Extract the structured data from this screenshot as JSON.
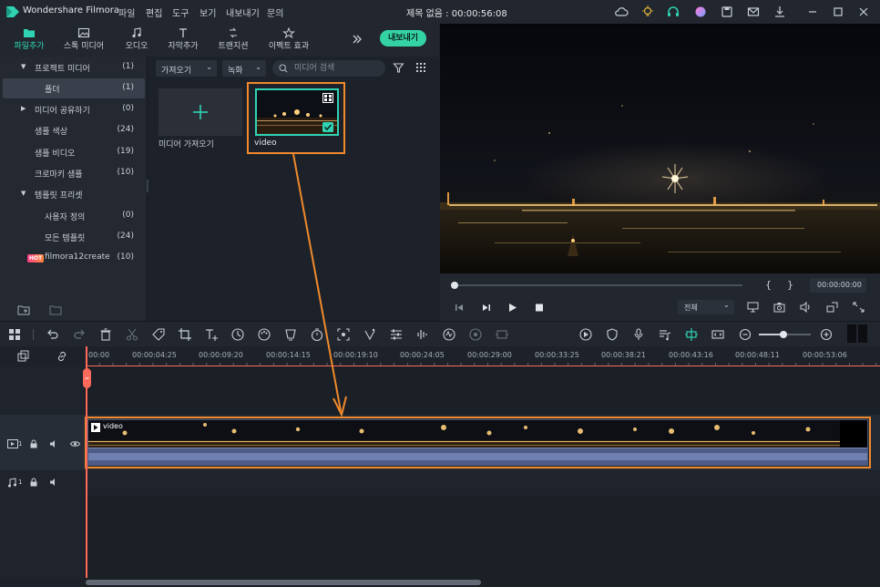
{
  "app": {
    "name": "Wondershare Filmora",
    "title": "제목 없음 : 00:00:56:08",
    "menus": [
      "파일",
      "편집",
      "도구",
      "보기",
      "내보내기",
      "문의"
    ]
  },
  "tabs": [
    {
      "label": "파일추가",
      "icon": "folder-icon",
      "active": true
    },
    {
      "label": "스톡 미디어",
      "icon": "image-icon"
    },
    {
      "label": "오디오",
      "icon": "music-note-icon"
    },
    {
      "label": "자막추가",
      "icon": "text-icon"
    },
    {
      "label": "트랜지션",
      "icon": "transition-icon"
    },
    {
      "label": "이펙트 효과",
      "icon": "effects-icon"
    }
  ],
  "export_label": "내보내기",
  "sidebar": {
    "items": [
      {
        "label": "프로젝트 미디어",
        "count": "(1)",
        "expander": "▼",
        "level": 0
      },
      {
        "label": "폴더",
        "count": "(1)",
        "level": 1,
        "selected": true
      },
      {
        "label": "미디어 공유하기",
        "count": "(0)",
        "expander": "▶",
        "level": 0
      },
      {
        "label": "샘플 색상",
        "count": "(24)",
        "level": 1
      },
      {
        "label": "샘플 비디오",
        "count": "(19)",
        "level": 1
      },
      {
        "label": "크로마키 샘플",
        "count": "(10)",
        "level": 1
      },
      {
        "label": "템플릿 프리셋",
        "count": "",
        "expander": "▼",
        "level": 0
      },
      {
        "label": "사용자 정의",
        "count": "(0)",
        "level": 2
      },
      {
        "label": "모든 템플릿",
        "count": "(24)",
        "level": 2
      },
      {
        "label": "filmora12create",
        "count": "(10)",
        "level": 0,
        "badge": "HOT"
      }
    ]
  },
  "media": {
    "import_dropdown": "가져오기",
    "record_dropdown": "녹화",
    "search_placeholder": "미디어 검색",
    "import_tile_label": "미디어 가져오기",
    "video_label": "video"
  },
  "preview": {
    "brace_open": "{",
    "brace_close": "}",
    "timecode": "00:00:00:00",
    "quality": "전체",
    "progress": 0
  },
  "timeline": {
    "ruler": [
      "00:00",
      "00:00:04:25",
      "00:00:09:20",
      "00:00:14:15",
      "00:00:19:10",
      "00:00:24:05",
      "00:00:29:00",
      "00:00:33:25",
      "00:00:38:21",
      "00:00:43:16",
      "00:00:48:11",
      "00:00:53:06"
    ],
    "video_track_num": "1",
    "audio_track_num": "1",
    "clip_label": "video"
  },
  "colors": {
    "accent": "#2fd3b3",
    "export": "#34d3a4",
    "highlight": "#f08a2c",
    "playhead": "#ff6a5a"
  }
}
